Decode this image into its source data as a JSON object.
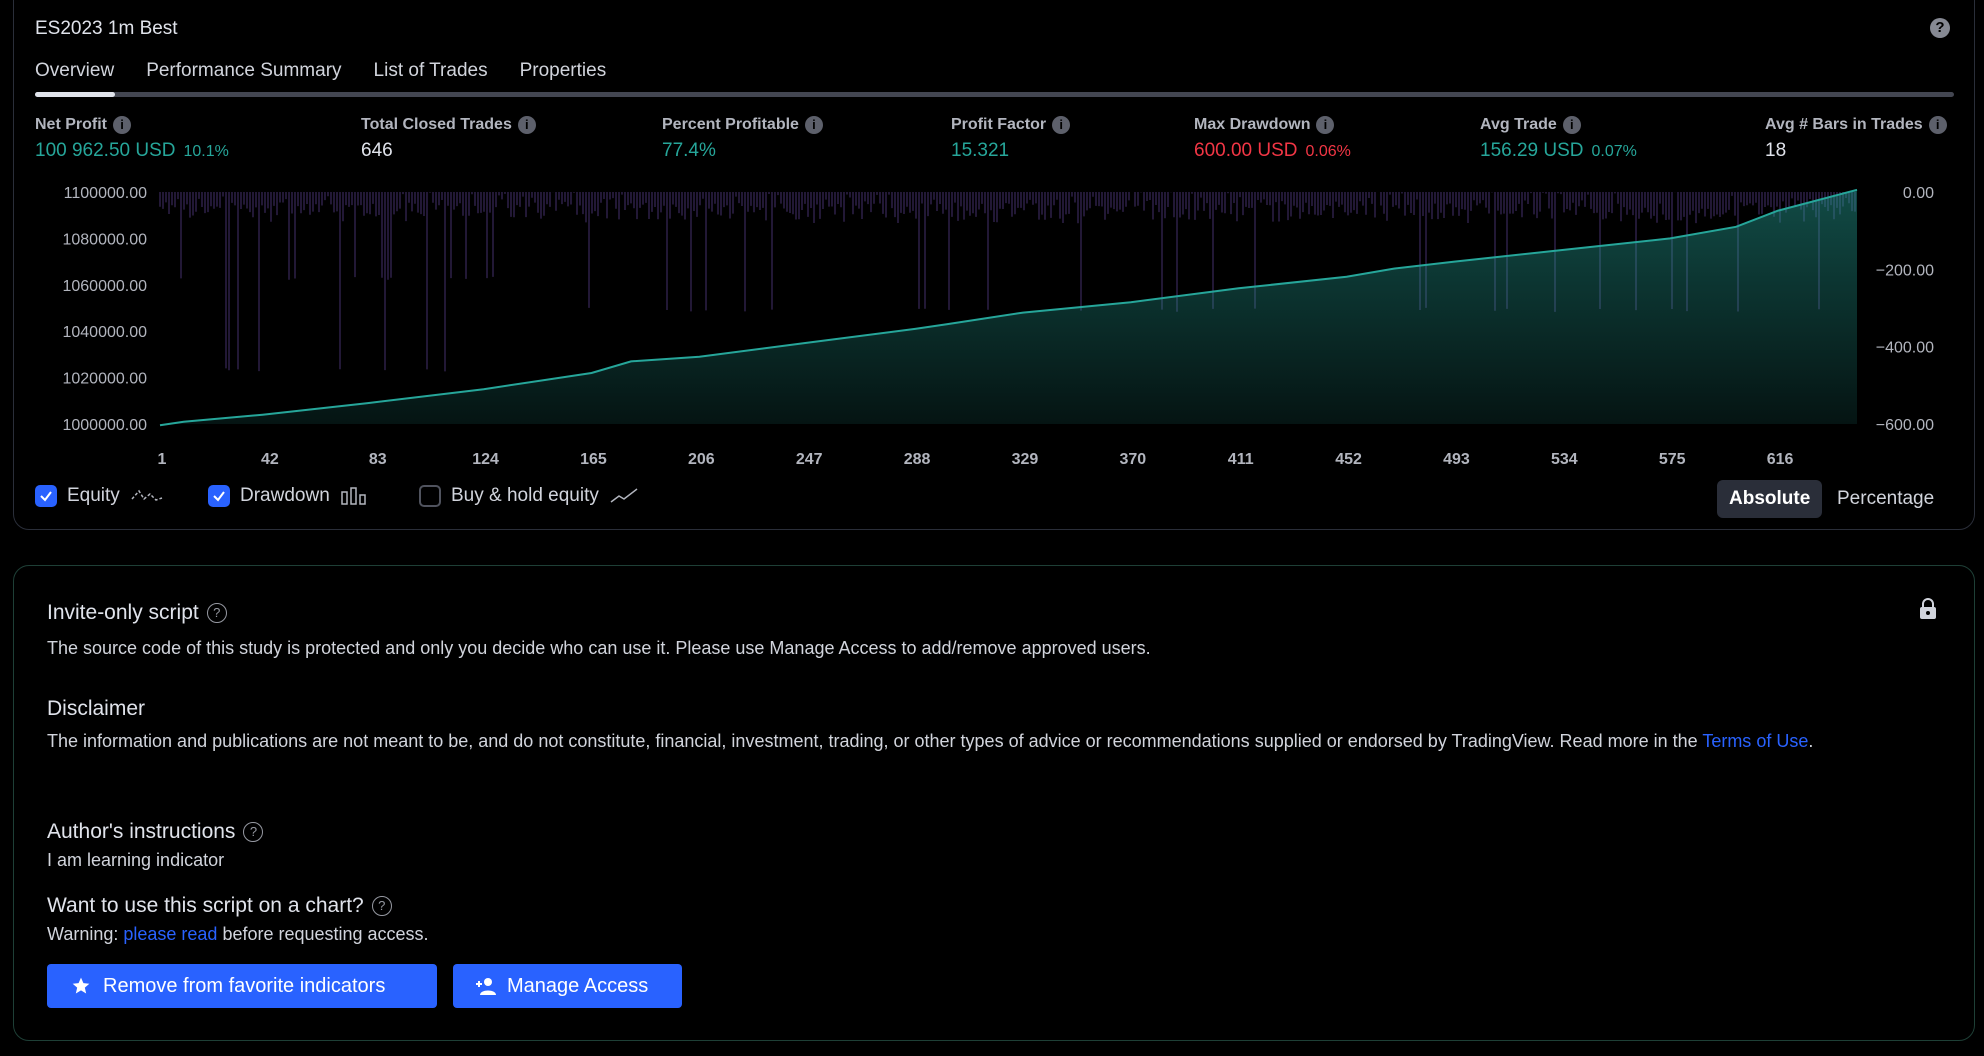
{
  "report": {
    "title": "ES2023 1m Best",
    "tabs": [
      "Overview",
      "Performance Summary",
      "List of Trades",
      "Properties"
    ],
    "metrics": [
      {
        "label": "Net Profit",
        "value": "100 962.50 USD",
        "sub": "10.1%",
        "color": "#26a69a"
      },
      {
        "label": "Total Closed Trades",
        "value": "646",
        "sub": "",
        "color": "#e0e3eb"
      },
      {
        "label": "Percent Profitable",
        "value": "77.4%",
        "sub": "",
        "color": "#26a69a"
      },
      {
        "label": "Profit Factor",
        "value": "15.321",
        "sub": "",
        "color": "#26a69a"
      },
      {
        "label": "Max Drawdown",
        "value": "600.00 USD",
        "sub": "0.06%",
        "color": "#f23645"
      },
      {
        "label": "Avg Trade",
        "value": "156.29 USD",
        "sub": "0.07%",
        "color": "#26a69a"
      },
      {
        "label": "Avg # Bars in Trades",
        "value": "18",
        "sub": "",
        "color": "#e0e3eb"
      }
    ],
    "legend": {
      "equity": "Equity",
      "drawdown": "Drawdown",
      "buy_hold": "Buy & hold equity"
    },
    "toggle": {
      "absolute": "Absolute",
      "percentage": "Percentage"
    }
  },
  "chart_data": {
    "type": "area",
    "x_ticks": [
      "1",
      "42",
      "83",
      "124",
      "165",
      "206",
      "247",
      "288",
      "329",
      "370",
      "411",
      "452",
      "493",
      "534",
      "575",
      "616"
    ],
    "y_left_ticks": [
      "1100000.00",
      "1080000.00",
      "1060000.00",
      "1040000.00",
      "1020000.00",
      "1000000.00"
    ],
    "y_right_ticks": [
      "0.00",
      "−200.00",
      "−400.00",
      "−600.00"
    ],
    "x_range": [
      1,
      646
    ],
    "y_left_range": [
      1000000,
      1100000
    ],
    "y_right_range": [
      -600,
      0
    ],
    "equity": {
      "x": [
        1,
        10,
        40,
        80,
        124,
        165,
        180,
        206,
        247,
        288,
        300,
        329,
        370,
        411,
        452,
        470,
        493,
        534,
        575,
        600,
        616,
        646
      ],
      "y": [
        999500,
        1001000,
        1004000,
        1009000,
        1015000,
        1022000,
        1027000,
        1029000,
        1035000,
        1041000,
        1043000,
        1048000,
        1052500,
        1058500,
        1063500,
        1067000,
        1070000,
        1075000,
        1080000,
        1085000,
        1092000,
        1100962.5
      ]
    },
    "drawdown_color": "#7e57c2",
    "equity_color": "#26a69a"
  },
  "invite": {
    "heading": "Invite-only script",
    "text": "The source code of this study is protected and only you decide who can use it. Please use Manage Access to add/remove approved users."
  },
  "disclaimer": {
    "heading": "Disclaimer",
    "text": "The information and publications are not meant to be, and do not constitute, financial, investment, trading, or other types of advice or recommendations supplied or endorsed by TradingView. Read more in the ",
    "link": "Terms of Use",
    "after": "."
  },
  "author": {
    "heading": "Author's instructions",
    "text": "I am learning indicator"
  },
  "use_script": {
    "heading": "Want to use this script on a chart?",
    "warning_prefix": "Warning: ",
    "warning_link": "please read",
    "warning_suffix": " before requesting access."
  },
  "buttons": {
    "remove_favorite": "Remove from favorite indicators",
    "manage_access": "Manage Access"
  }
}
